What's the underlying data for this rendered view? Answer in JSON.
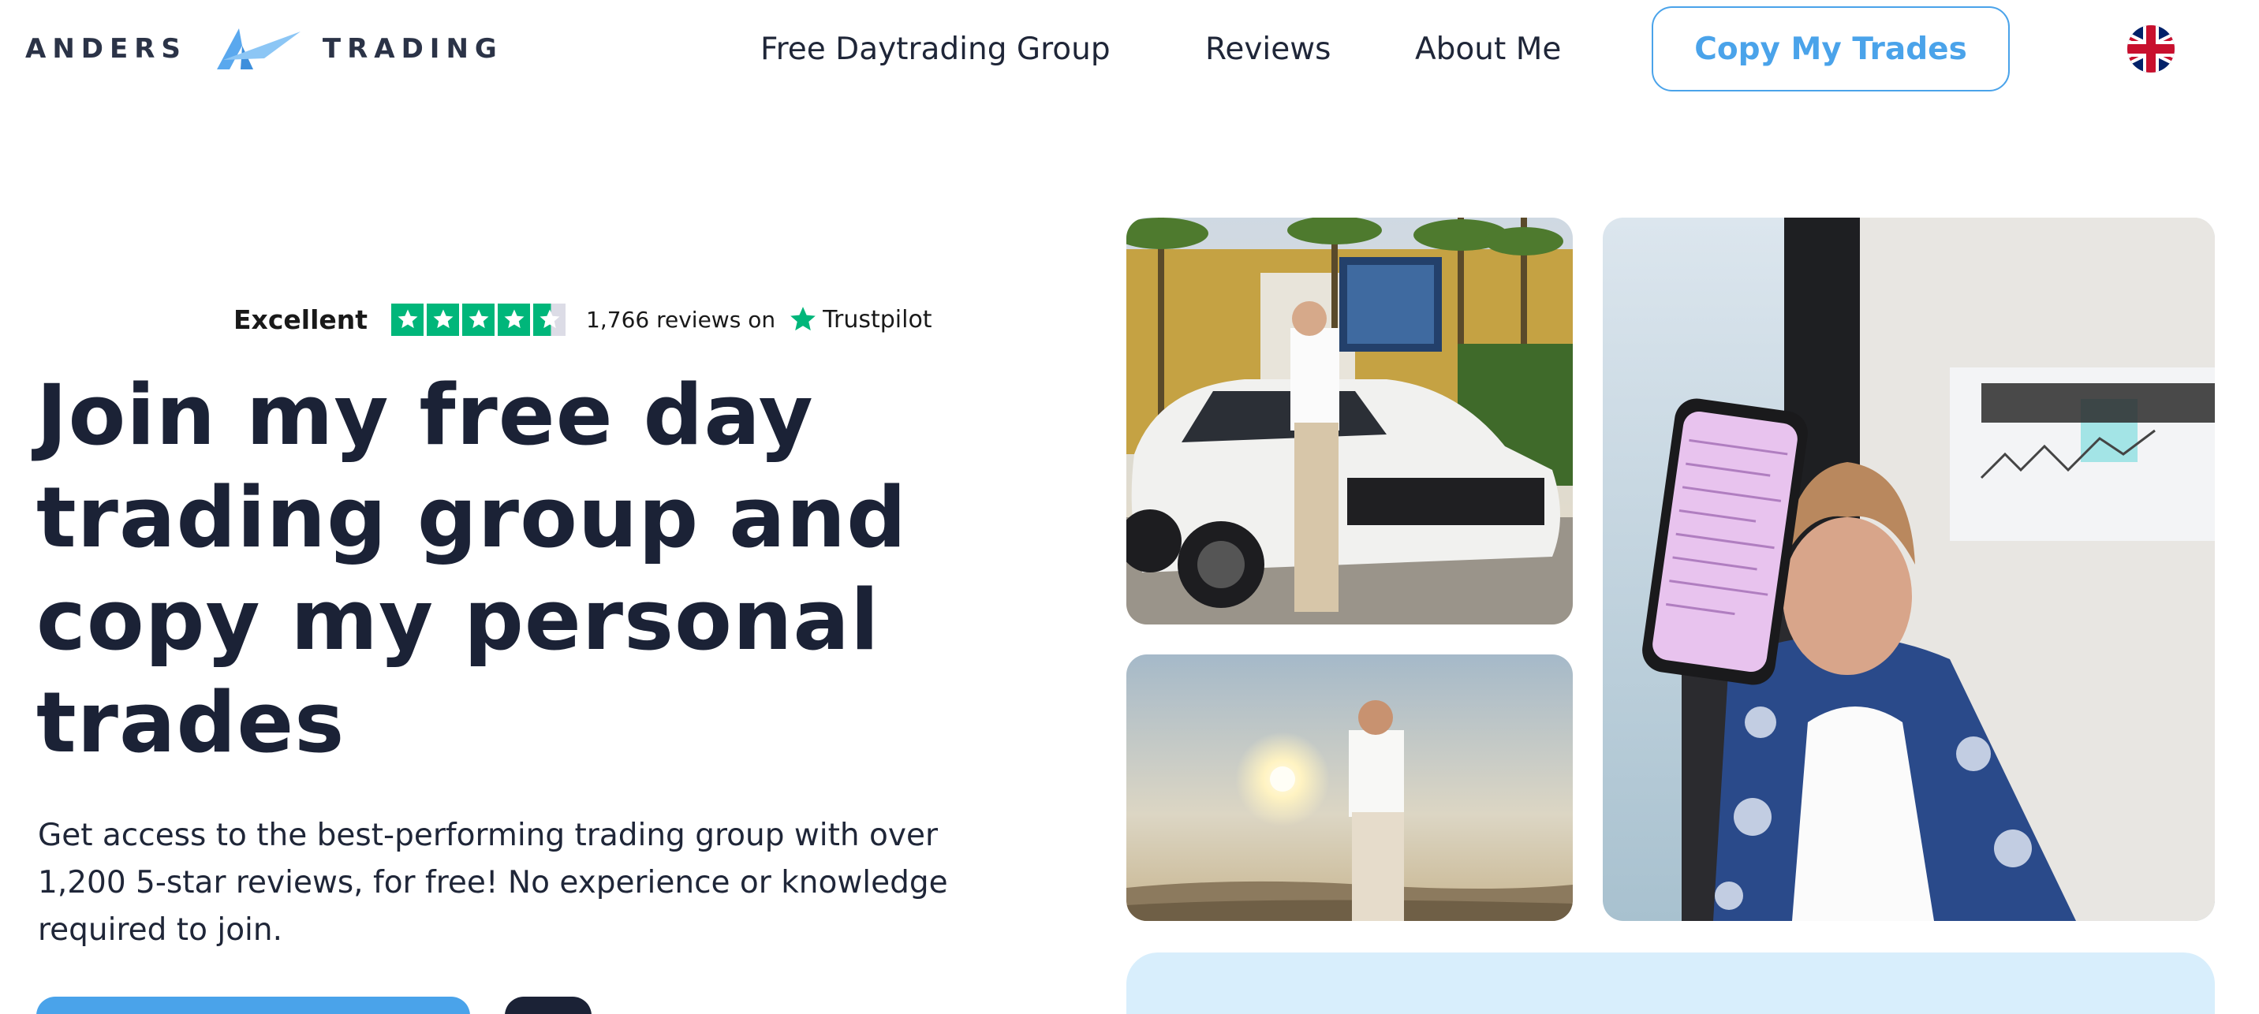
{
  "header": {
    "logo": {
      "left_word": "ANDERS",
      "right_word": "TRADING",
      "mark_icon": "triangle-arrow-logo"
    },
    "nav": [
      {
        "label": "Free Daytrading Group"
      },
      {
        "label": "Reviews"
      },
      {
        "label": "About Me"
      }
    ],
    "cta_label": "Copy My Trades",
    "language_icon": "uk-flag-icon"
  },
  "trustpilot": {
    "rating_word": "Excellent",
    "stars": 4.5,
    "review_count_text": "1,766 reviews on",
    "brand": "Trustpilot"
  },
  "hero": {
    "title_lines": [
      "Join my free day",
      "trading group and",
      "copy my personal",
      "trades"
    ],
    "subtitle_lines": [
      "Get access to the best-performing trading group with over",
      "1,200 5-star reviews, for free! No experience or knowledge",
      "required to join."
    ]
  },
  "photos": [
    {
      "name": "man-with-white-suv-photo"
    },
    {
      "name": "man-in-desert-sunset-photo"
    },
    {
      "name": "man-holding-phone-photo"
    }
  ],
  "colors": {
    "accent": "#4aa3ea",
    "heading": "#1b2236",
    "trustpilot_green": "#00b67a",
    "panel_blue": "#d8eefc"
  }
}
